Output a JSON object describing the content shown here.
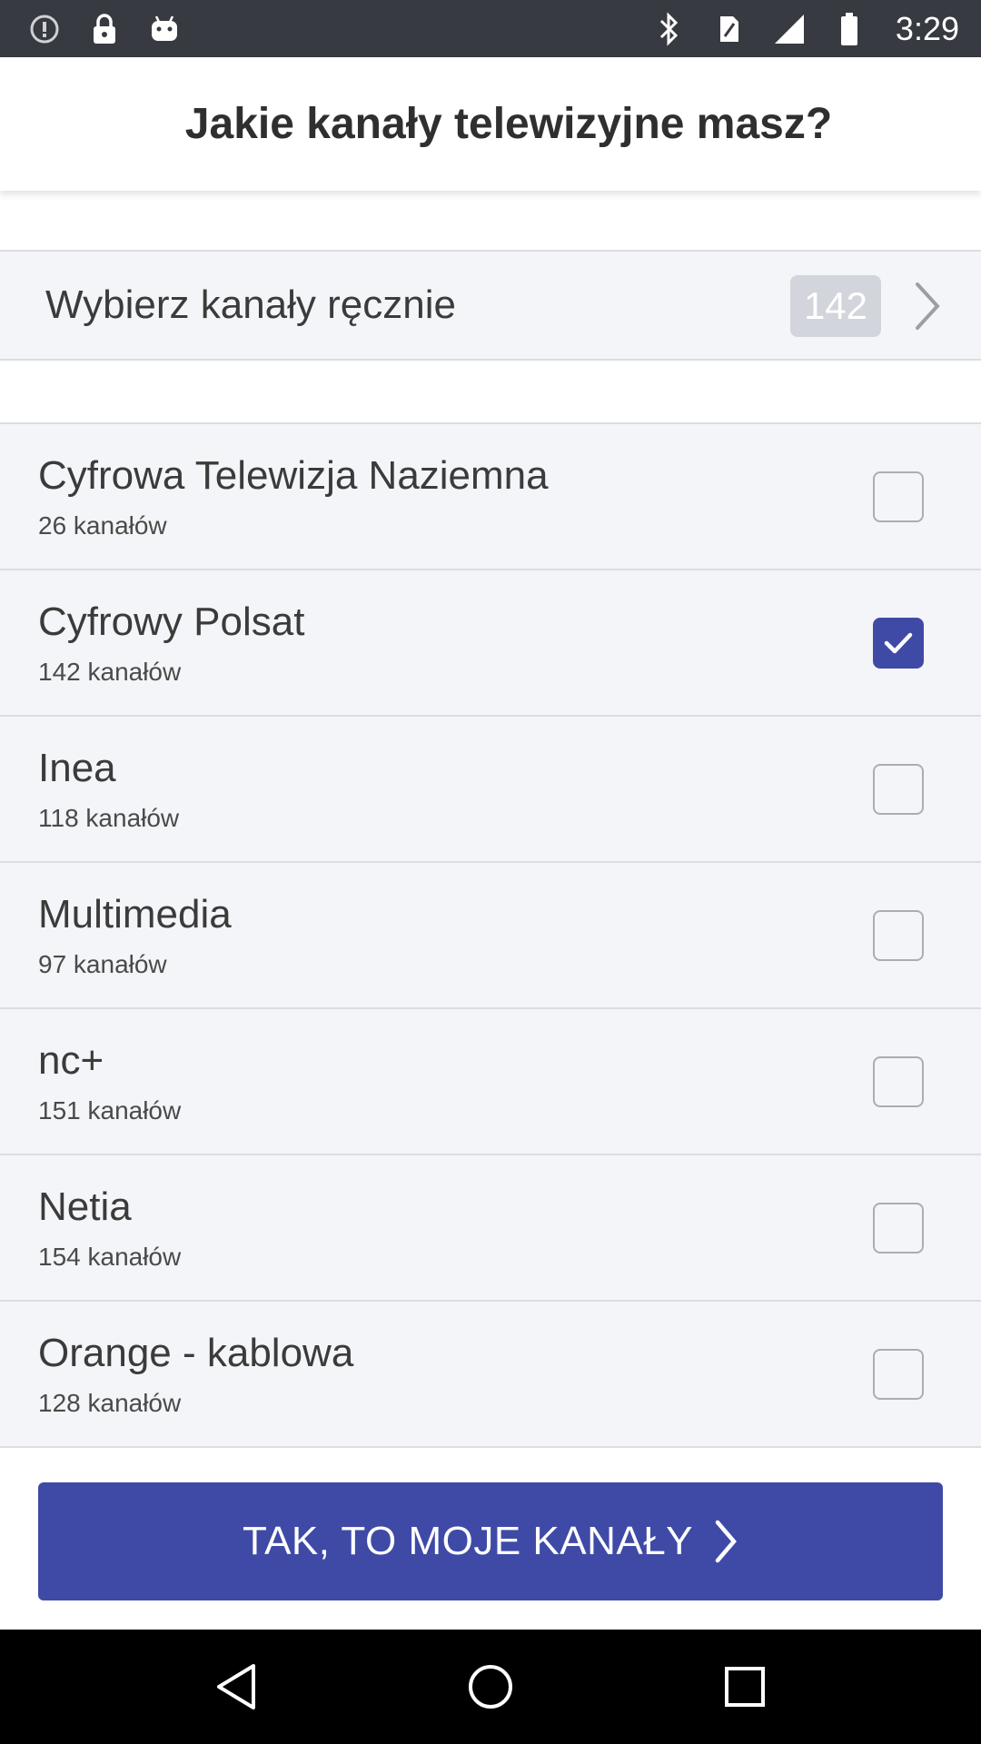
{
  "status_bar": {
    "time": "3:29",
    "left_icons": [
      "alert-icon",
      "lock-icon",
      "android-icon"
    ],
    "right_icons": [
      "bluetooth-icon",
      "sim-icon",
      "signal-icon",
      "battery-icon"
    ]
  },
  "header": {
    "title": "Jakie kanały telewizyjne masz?"
  },
  "manual_select": {
    "label": "Wybierz kanały ręcznie",
    "count": "142"
  },
  "providers": [
    {
      "name": "Cyfrowa Telewizja Naziemna",
      "count_label": "26 kanałów",
      "checked": false
    },
    {
      "name": "Cyfrowy Polsat",
      "count_label": "142 kanałów",
      "checked": true
    },
    {
      "name": "Inea",
      "count_label": "118 kanałów",
      "checked": false
    },
    {
      "name": "Multimedia",
      "count_label": "97 kanałów",
      "checked": false
    },
    {
      "name": "nc+",
      "count_label": "151 kanałów",
      "checked": false
    },
    {
      "name": "Netia",
      "count_label": "154 kanałów",
      "checked": false
    },
    {
      "name": "Orange - kablowa",
      "count_label": "128 kanałów",
      "checked": false
    }
  ],
  "cta": {
    "label": "TAK, TO MOJE KANAŁY"
  },
  "nav_bar": {
    "buttons": [
      "back-icon",
      "home-icon",
      "recents-icon"
    ]
  },
  "colors": {
    "accent": "#3f4aa6",
    "status_bar": "#373a40",
    "row_background": "#f4f5f8",
    "badge": "#d2d5db"
  }
}
